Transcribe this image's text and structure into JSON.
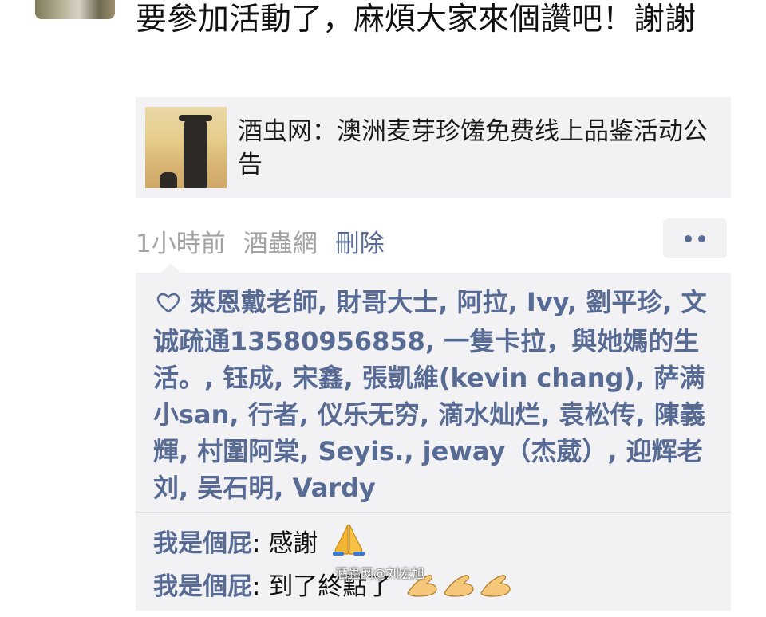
{
  "post": {
    "text": "要參加活動了，麻煩大家來個讚吧！謝謝"
  },
  "link_card": {
    "title": "酒虫网：澳洲麦芽珍馐免费线上品鉴活动公告"
  },
  "meta": {
    "time": "1小時前",
    "source": "酒蟲網",
    "delete_label": "刪除"
  },
  "likes": {
    "icon": "heart-outline-icon",
    "names": "萊恩戴老師, 財哥大士, 阿拉, Ivy, 劉平珍, 文诚疏通13580956858, 一隻卡拉，與她媽的生活。, 钰成, 宋鑫, 張凱維(kevin chang), 萨满小san, 行者, 仪乐无穷, 滴水灿烂, 袁松传, 陳義輝, 村圍阿棠, Seyis., jeway（杰葳）, 迎辉老刘, 吴石明, Vardy"
  },
  "comments": [
    {
      "author": "我是個屁",
      "separator": ": ",
      "text": "感謝",
      "emoji": "folded-hands-icon"
    },
    {
      "author": "我是個屁",
      "separator": ": ",
      "text": "到了終點了",
      "emoji": "hand-icon"
    }
  ],
  "watermark": "酒蟲网@刘宏旭",
  "colors": {
    "link_blue": "#576b95",
    "panel_gray": "#f2f2f4",
    "meta_gray": "#a3a3a3"
  }
}
